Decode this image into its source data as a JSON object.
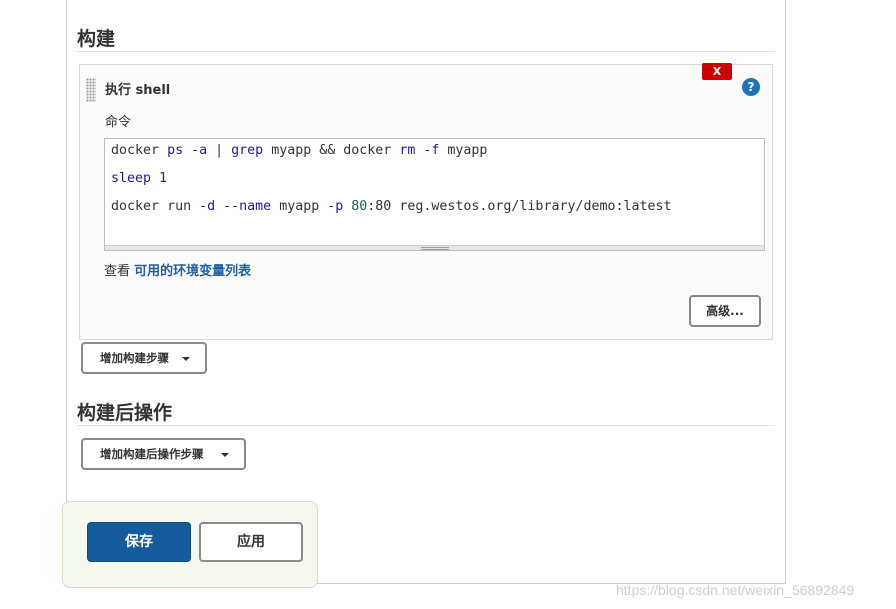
{
  "build": {
    "section_title": "构建",
    "step": {
      "title": "执行 shell",
      "delete_label": "X",
      "help_label": "?",
      "command_label": "命令",
      "command_lines": [
        "docker ps -a | grep myapp && docker rm -f myapp",
        "sleep 1",
        "docker run -d --name myapp -p 80:80 reg.westos.org/library/demo:latest"
      ],
      "env_hint_prefix": "查看 ",
      "env_link": "可用的环境变量列表",
      "advanced_label": "高级..."
    },
    "add_step_label": "增加构建步骤"
  },
  "post_build": {
    "section_title": "构建后操作",
    "add_step_label": "增加构建后操作步骤"
  },
  "actions": {
    "save_label": "保存",
    "apply_label": "应用"
  },
  "watermark": "https://blog.csdn.net/weixin_56892849",
  "colors": {
    "save_bg": "#155c9c",
    "delete_bg": "#cc0000",
    "help_bg": "#1f73b7",
    "link": "#1f5fa8",
    "savebar_bg": "#f4f8ef"
  },
  "icons": {
    "delete": "close-icon",
    "help": "help-icon",
    "drag": "drag-handle-icon",
    "dropdown": "caret-down-icon"
  }
}
